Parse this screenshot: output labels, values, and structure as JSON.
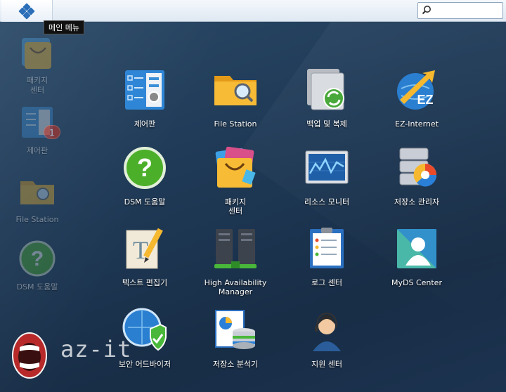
{
  "taskbar": {
    "main_menu_tooltip": "메인 메뉴"
  },
  "desktop_shortcuts": [
    {
      "label_line1": "패키지",
      "label_line2": "센터",
      "icon": "package-center-icon"
    },
    {
      "label_line1": "제어판",
      "label_line2": "",
      "icon": "control-panel-icon"
    },
    {
      "label_line1": "File Station",
      "label_line2": "",
      "icon": "file-station-icon"
    },
    {
      "label_line1": "DSM 도움말",
      "label_line2": "",
      "icon": "dsm-help-icon"
    }
  ],
  "control_panel_badge": "1",
  "apps": [
    {
      "label_line1": "제어판",
      "label_line2": "",
      "icon": "control-panel-icon"
    },
    {
      "label_line1": "File Station",
      "label_line2": "",
      "icon": "file-station-icon"
    },
    {
      "label_line1": "백업 및 복제",
      "label_line2": "",
      "icon": "backup-replication-icon"
    },
    {
      "label_line1": "EZ-Internet",
      "label_line2": "",
      "icon": "ez-internet-icon"
    },
    {
      "label_line1": "DSM 도움말",
      "label_line2": "",
      "icon": "dsm-help-icon"
    },
    {
      "label_line1": "패키지",
      "label_line2": "센터",
      "icon": "package-center-icon"
    },
    {
      "label_line1": "리소스 모니터",
      "label_line2": "",
      "icon": "resource-monitor-icon"
    },
    {
      "label_line1": "저장소 관리자",
      "label_line2": "",
      "icon": "storage-manager-icon"
    },
    {
      "label_line1": "텍스트 편집기",
      "label_line2": "",
      "icon": "text-editor-icon"
    },
    {
      "label_line1": "High Availability",
      "label_line2": "Manager",
      "icon": "high-availability-icon"
    },
    {
      "label_line1": "로그 센터",
      "label_line2": "",
      "icon": "log-center-icon"
    },
    {
      "label_line1": "MyDS Center",
      "label_line2": "",
      "icon": "myds-center-icon"
    },
    {
      "label_line1": "보안 어드바이저",
      "label_line2": "",
      "icon": "security-advisor-icon"
    },
    {
      "label_line1": "저장소 분석기",
      "label_line2": "",
      "icon": "storage-analyzer-icon"
    },
    {
      "label_line1": "지원 센터",
      "label_line2": "",
      "icon": "support-center-icon"
    }
  ],
  "watermark_text": "az-it",
  "colors": {
    "accent": "#2a6fb8",
    "badge": "#c8301f",
    "help_green": "#4caf2a",
    "folder_yellow": "#f5b82e"
  }
}
